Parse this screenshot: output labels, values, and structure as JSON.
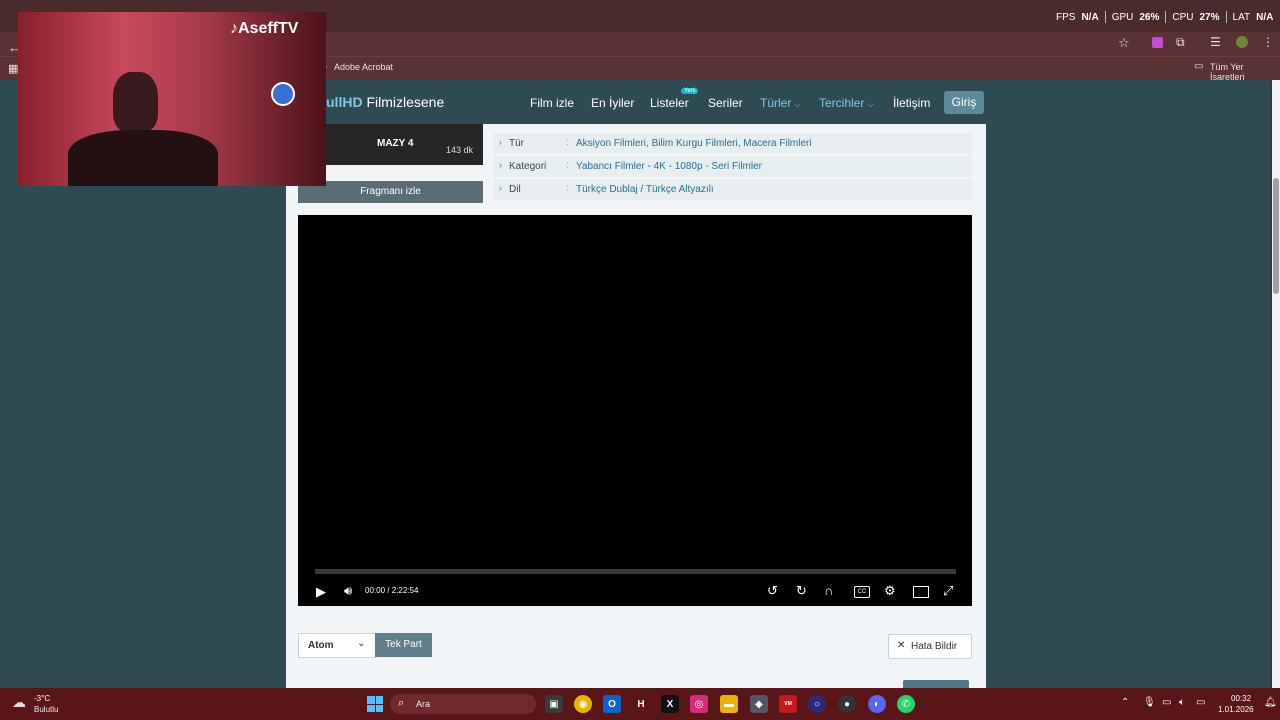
{
  "overlay": {
    "fps_label": "FPS",
    "fps_value": "N/A",
    "gpu_label": "GPU",
    "gpu_value": "26%",
    "cpu_label": "CPU",
    "cpu_value": "27%",
    "lat_label": "LAT",
    "lat_value": "N/A"
  },
  "webcam": {
    "handle": "AseffTV"
  },
  "bookmarks": {
    "item1": "Adobe Acrobat",
    "all": "Tüm Yer İşaretleri"
  },
  "site": {
    "logo_a": "ullHD",
    "logo_b": "Filmizlesene",
    "nav": {
      "film_izle": "Film izle",
      "en_iyiler": "En İyiler",
      "listeler": "Listeler",
      "listeler_badge": "Yeni",
      "seriler": "Seriler",
      "turler": "Türler",
      "tercihler": "Tercihler",
      "iletisim": "İletişim",
      "giris": "Giriş"
    }
  },
  "movie": {
    "poster_title": "MAZY 4",
    "duration": "143 dk",
    "trailer": "Fragmanı izle",
    "info": [
      {
        "key": "Tür",
        "value": "Aksiyon Filmleri, Bilim Kurgu Filmleri, Macera Filmleri"
      },
      {
        "key": "Kategori",
        "value": "Yabancı Filmler - 4K - 1080p - Seri Filmler"
      },
      {
        "key": "Dil",
        "value": "Türkçe Dublaj / Türkçe Altyazılı"
      }
    ]
  },
  "player": {
    "current_time": "00:00",
    "separator": "/",
    "total_time": "2:22:54",
    "progress": 0
  },
  "controls": {
    "source_select": "Atom",
    "part_button": "Tek Part",
    "report_button": "Hata Bildir"
  },
  "taskbar": {
    "weather_temp": "-3°C",
    "weather_desc": "Bulutlu",
    "search_placeholder": "Ara",
    "time": "00:32",
    "date": "1.01.2026"
  }
}
